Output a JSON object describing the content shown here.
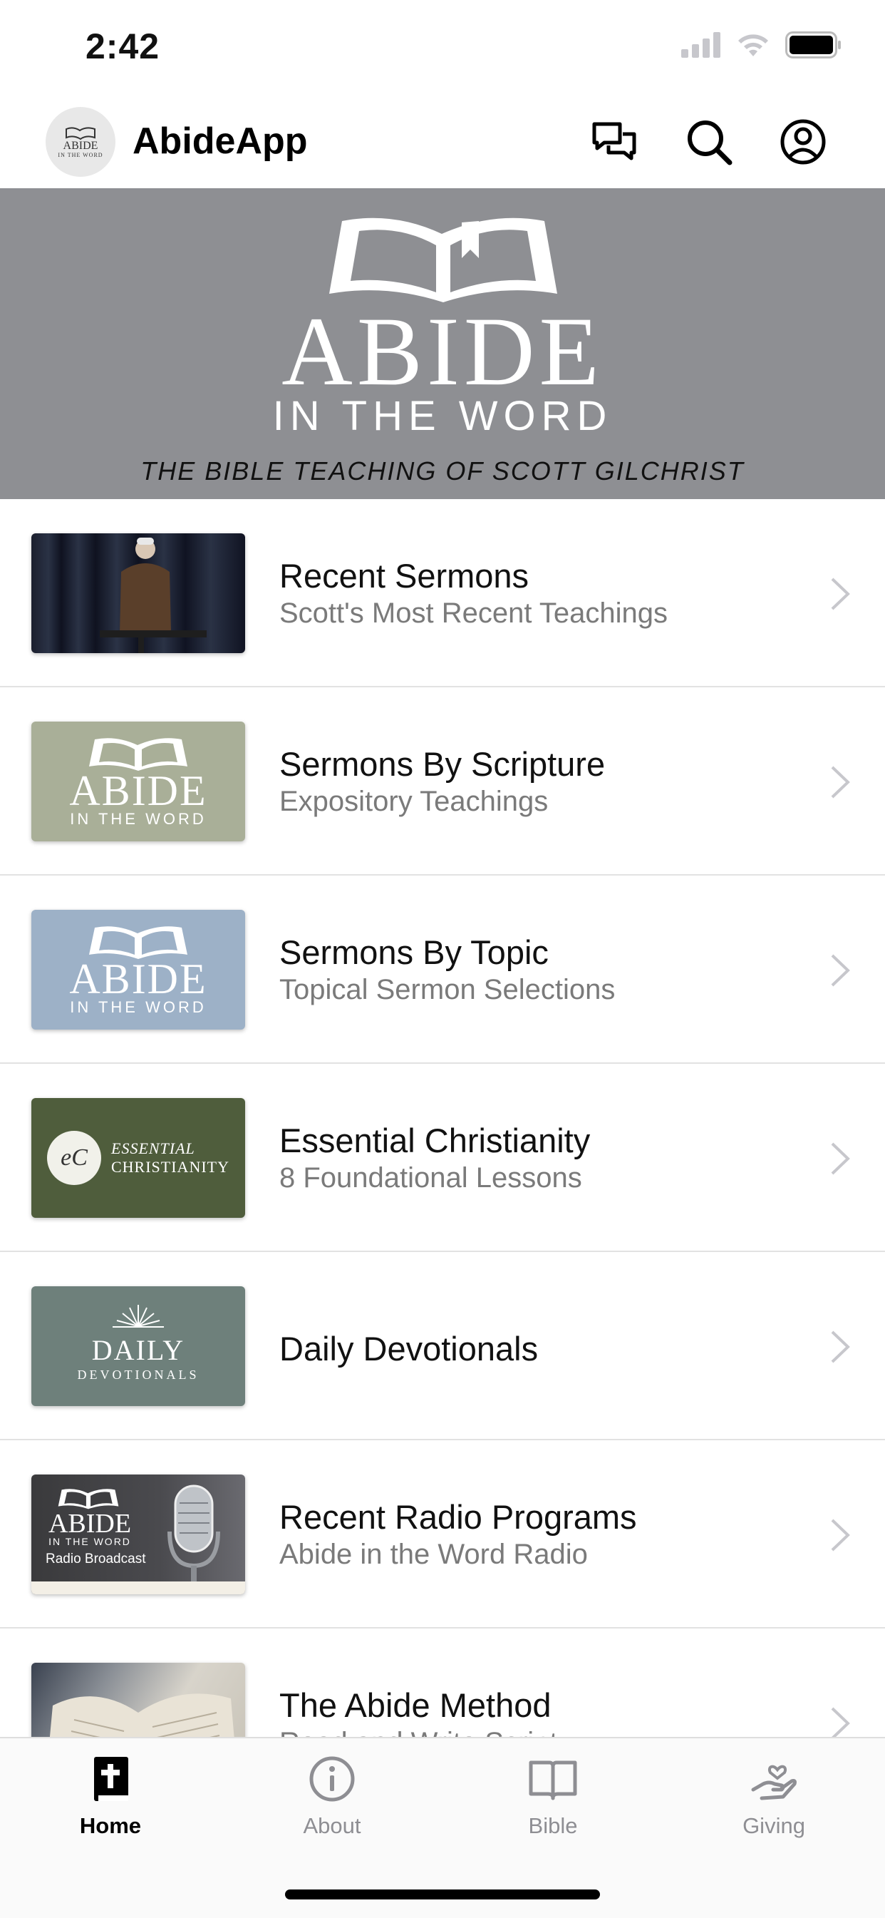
{
  "status_bar": {
    "time": "2:42"
  },
  "header": {
    "app_name": "AbideApp",
    "logo_line1": "ABIDE",
    "logo_line2": "IN THE WORD"
  },
  "banner": {
    "title": "ABIDE",
    "subtitle": "IN THE WORD",
    "tagline": "THE BIBLE TEACHING OF SCOTT GILCHRIST"
  },
  "items": [
    {
      "title": "Recent Sermons",
      "subtitle": "Scott's Most Recent Teachings",
      "thumb": "sermon-photo"
    },
    {
      "title": "Sermons By Scripture",
      "subtitle": "Expository Teachings",
      "thumb": "abide-logo",
      "thumb_line1": "ABIDE",
      "thumb_line2": "IN THE WORD",
      "thumb_color": "#a9af98"
    },
    {
      "title": "Sermons By Topic",
      "subtitle": "Topical Sermon Selections",
      "thumb": "abide-logo",
      "thumb_line1": "ABIDE",
      "thumb_line2": "IN THE WORD",
      "thumb_color": "#9db1c7"
    },
    {
      "title": "Essential Christianity",
      "subtitle": "8 Foundational Lessons",
      "thumb": "ec-logo",
      "thumb_badge": "eC",
      "thumb_line1": "ESSENTIAL",
      "thumb_line2": "CHRISTIANITY",
      "thumb_color": "#4f5d3c"
    },
    {
      "title": "Daily Devotionals",
      "subtitle": "",
      "thumb": "daily-logo",
      "thumb_line1": "DAILY",
      "thumb_line2": "DEVOTIONALS",
      "thumb_color": "#6e807b"
    },
    {
      "title": "Recent Radio Programs",
      "subtitle": "Abide in the Word Radio",
      "thumb": "radio",
      "thumb_line1": "ABIDE",
      "thumb_line2": "IN THE WORD",
      "thumb_line3": "Radio Broadcast",
      "thumb_color": "#3a3a3c"
    },
    {
      "title": "The Abide Method",
      "subtitle": "Read and Write Script",
      "thumb": "bible-photo"
    }
  ],
  "tabs": [
    {
      "label": "Home",
      "icon": "bible-cross-icon",
      "active": true
    },
    {
      "label": "About",
      "icon": "info-icon",
      "active": false
    },
    {
      "label": "Bible",
      "icon": "open-book-icon",
      "active": false
    },
    {
      "label": "Giving",
      "icon": "giving-hand-icon",
      "active": false
    }
  ],
  "colors": {
    "banner_bg": "#8e8f93",
    "accent_text": "#111111",
    "subtle_text": "#7a7a7a"
  }
}
